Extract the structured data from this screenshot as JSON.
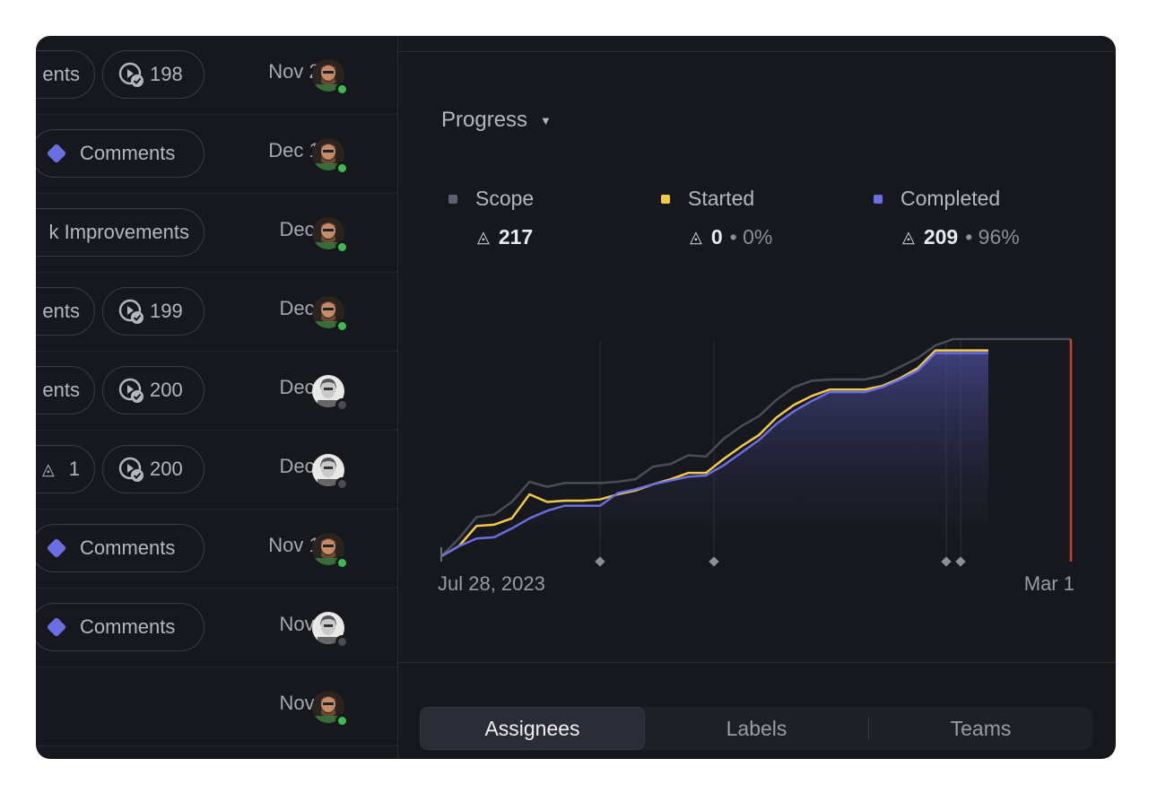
{
  "list": {
    "rows": [
      {
        "pills": [
          {
            "kind": "text",
            "text": "ents"
          },
          {
            "kind": "cycle",
            "text": "198"
          }
        ],
        "date": "Nov 20",
        "avatar": "avatar-a",
        "status": "online"
      },
      {
        "pills": [
          {
            "kind": "diamond",
            "text": "Comments"
          }
        ],
        "date": "Dec 15",
        "avatar": "avatar-a",
        "status": "online"
      },
      {
        "pills": [
          {
            "kind": "text",
            "text": "k Improvements"
          }
        ],
        "date": "Dec 8",
        "avatar": "avatar-a",
        "status": "online"
      },
      {
        "pills": [
          {
            "kind": "text",
            "text": "ents"
          },
          {
            "kind": "cycle",
            "text": "199"
          }
        ],
        "date": "Dec 6",
        "avatar": "avatar-a",
        "status": "online"
      },
      {
        "pills": [
          {
            "kind": "text",
            "text": "ents"
          },
          {
            "kind": "cycle",
            "text": "200"
          }
        ],
        "date": "Dec 5",
        "avatar": "avatar-b",
        "status": "offline"
      },
      {
        "pills": [
          {
            "kind": "estimate",
            "text": "1"
          },
          {
            "kind": "cycle",
            "text": "200"
          }
        ],
        "date": "Dec 5",
        "avatar": "avatar-b",
        "status": "offline"
      },
      {
        "pills": [
          {
            "kind": "diamond",
            "text": "Comments"
          }
        ],
        "date": "Nov 16",
        "avatar": "avatar-a",
        "status": "online"
      },
      {
        "pills": [
          {
            "kind": "diamond",
            "text": "Comments"
          }
        ],
        "date": "Nov 3",
        "avatar": "avatar-b",
        "status": "offline"
      },
      {
        "pills": [],
        "date": "Nov 2",
        "avatar": "avatar-a",
        "status": "online"
      }
    ]
  },
  "panel": {
    "progress_label": "Progress",
    "caret": "▼",
    "stats": [
      {
        "label": "Scope",
        "value": "217",
        "pct": "",
        "color": "#5e6070"
      },
      {
        "label": "Started",
        "value": "0",
        "pct": "• 0%",
        "color": "#f2c94c"
      },
      {
        "label": "Completed",
        "value": "209",
        "pct": "• 96%",
        "color": "#6b6ee0"
      }
    ],
    "tri_glyph": "◬",
    "x_start_label": "Jul 28, 2023",
    "x_end_label": "Mar 1",
    "tabs": [
      "Assignees",
      "Labels",
      "Teams"
    ]
  },
  "colors": {
    "scope": "#4b4c5a",
    "started": "#f2c94c",
    "completed": "#6b6ee0",
    "target_line": "#c0453e",
    "status_online": "#3fb950",
    "status_offline": "#4a4b55"
  },
  "chart_data": {
    "type": "line",
    "x_start": "Jul 28, 2023",
    "x_end": "Mar 1",
    "series": [
      {
        "name": "Scope",
        "values": [
          0,
          14,
          31,
          33,
          43,
          59,
          55,
          58,
          58,
          58,
          59,
          61,
          71,
          73,
          80,
          79,
          93,
          103,
          111,
          124,
          134,
          139,
          140,
          140,
          140,
          143,
          150,
          157,
          167,
          172,
          172,
          172
        ]
      },
      {
        "name": "Started",
        "values": [
          0,
          8,
          24,
          25,
          30,
          49,
          43,
          44,
          44,
          45,
          49,
          52,
          57,
          61,
          66,
          66,
          77,
          87,
          96,
          110,
          120,
          127,
          132,
          132,
          132,
          135,
          141,
          149,
          163,
          163,
          163,
          163
        ]
      },
      {
        "name": "Completed",
        "values": [
          0,
          8,
          14,
          15,
          22,
          30,
          36,
          40,
          40,
          40,
          50,
          53,
          57,
          60,
          63,
          64,
          72,
          82,
          92,
          105,
          115,
          123,
          130,
          130,
          130,
          134,
          140,
          147,
          161,
          161,
          161,
          161
        ]
      }
    ],
    "markers": 4
  }
}
